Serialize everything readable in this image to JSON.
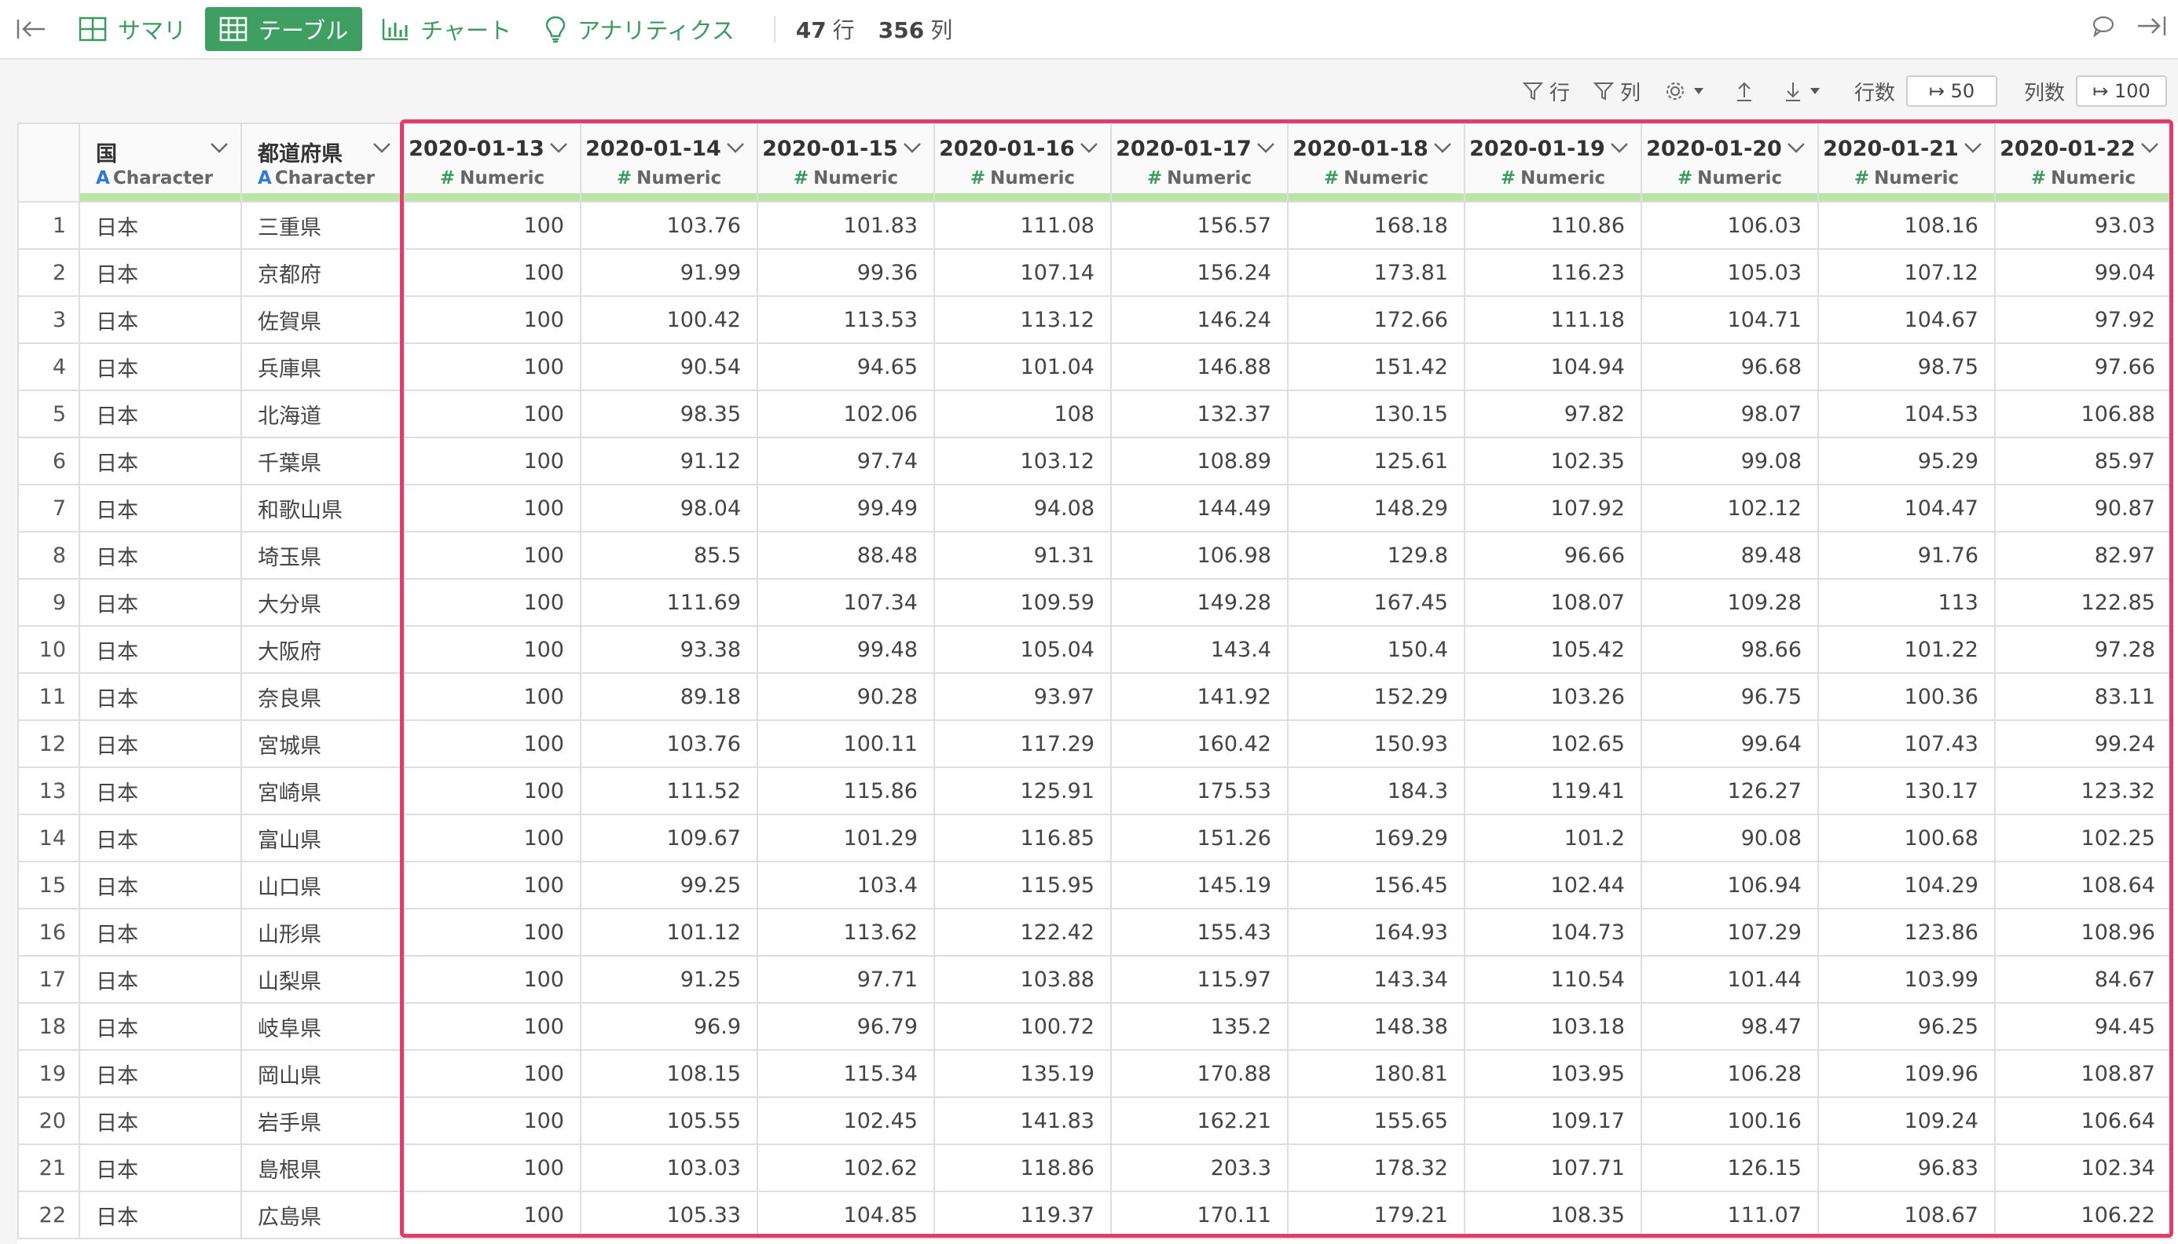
{
  "tabs": [
    {
      "label": "サマリ",
      "icon": "summary-grid-icon",
      "active": false
    },
    {
      "label": "テーブル",
      "icon": "table-icon",
      "active": true
    },
    {
      "label": "チャート",
      "icon": "bar-chart-icon",
      "active": false
    },
    {
      "label": "アナリティクス",
      "icon": "lightbulb-icon",
      "active": false
    }
  ],
  "counts": {
    "rows_value": "47",
    "rows_unit": "行",
    "cols_value": "356",
    "cols_unit": "列"
  },
  "toolbar": {
    "row_filter_label": "行",
    "col_filter_label": "列",
    "rows_label": "行数",
    "rows_value": "↦ 50",
    "cols_label": "列数",
    "cols_value": "↦ 100"
  },
  "colors": {
    "accent": "#3f9e61",
    "highlight": "#e23c6a",
    "type_bar": "#b9e6a7"
  },
  "table": {
    "columns": [
      {
        "name": "国",
        "type": "Character"
      },
      {
        "name": "都道府県",
        "type": "Character"
      },
      {
        "name": "2020-01-13",
        "type": "Numeric"
      },
      {
        "name": "2020-01-14",
        "type": "Numeric"
      },
      {
        "name": "2020-01-15",
        "type": "Numeric"
      },
      {
        "name": "2020-01-16",
        "type": "Numeric"
      },
      {
        "name": "2020-01-17",
        "type": "Numeric"
      },
      {
        "name": "2020-01-18",
        "type": "Numeric"
      },
      {
        "name": "2020-01-19",
        "type": "Numeric"
      },
      {
        "name": "2020-01-20",
        "type": "Numeric"
      },
      {
        "name": "2020-01-21",
        "type": "Numeric"
      },
      {
        "name": "2020-01-22",
        "type": "Numeric"
      }
    ],
    "rows": [
      [
        "1",
        "日本",
        "三重県",
        "100",
        "103.76",
        "101.83",
        "111.08",
        "156.57",
        "168.18",
        "110.86",
        "106.03",
        "108.16",
        "93.03"
      ],
      [
        "2",
        "日本",
        "京都府",
        "100",
        "91.99",
        "99.36",
        "107.14",
        "156.24",
        "173.81",
        "116.23",
        "105.03",
        "107.12",
        "99.04"
      ],
      [
        "3",
        "日本",
        "佐賀県",
        "100",
        "100.42",
        "113.53",
        "113.12",
        "146.24",
        "172.66",
        "111.18",
        "104.71",
        "104.67",
        "97.92"
      ],
      [
        "4",
        "日本",
        "兵庫県",
        "100",
        "90.54",
        "94.65",
        "101.04",
        "146.88",
        "151.42",
        "104.94",
        "96.68",
        "98.75",
        "97.66"
      ],
      [
        "5",
        "日本",
        "北海道",
        "100",
        "98.35",
        "102.06",
        "108",
        "132.37",
        "130.15",
        "97.82",
        "98.07",
        "104.53",
        "106.88"
      ],
      [
        "6",
        "日本",
        "千葉県",
        "100",
        "91.12",
        "97.74",
        "103.12",
        "108.89",
        "125.61",
        "102.35",
        "99.08",
        "95.29",
        "85.97"
      ],
      [
        "7",
        "日本",
        "和歌山県",
        "100",
        "98.04",
        "99.49",
        "94.08",
        "144.49",
        "148.29",
        "107.92",
        "102.12",
        "104.47",
        "90.87"
      ],
      [
        "8",
        "日本",
        "埼玉県",
        "100",
        "85.5",
        "88.48",
        "91.31",
        "106.98",
        "129.8",
        "96.66",
        "89.48",
        "91.76",
        "82.97"
      ],
      [
        "9",
        "日本",
        "大分県",
        "100",
        "111.69",
        "107.34",
        "109.59",
        "149.28",
        "167.45",
        "108.07",
        "109.28",
        "113",
        "122.85"
      ],
      [
        "10",
        "日本",
        "大阪府",
        "100",
        "93.38",
        "99.48",
        "105.04",
        "143.4",
        "150.4",
        "105.42",
        "98.66",
        "101.22",
        "97.28"
      ],
      [
        "11",
        "日本",
        "奈良県",
        "100",
        "89.18",
        "90.28",
        "93.97",
        "141.92",
        "152.29",
        "103.26",
        "96.75",
        "100.36",
        "83.11"
      ],
      [
        "12",
        "日本",
        "宮城県",
        "100",
        "103.76",
        "100.11",
        "117.29",
        "160.42",
        "150.93",
        "102.65",
        "99.64",
        "107.43",
        "99.24"
      ],
      [
        "13",
        "日本",
        "宮崎県",
        "100",
        "111.52",
        "115.86",
        "125.91",
        "175.53",
        "184.3",
        "119.41",
        "126.27",
        "130.17",
        "123.32"
      ],
      [
        "14",
        "日本",
        "富山県",
        "100",
        "109.67",
        "101.29",
        "116.85",
        "151.26",
        "169.29",
        "101.2",
        "90.08",
        "100.68",
        "102.25"
      ],
      [
        "15",
        "日本",
        "山口県",
        "100",
        "99.25",
        "103.4",
        "115.95",
        "145.19",
        "156.45",
        "102.44",
        "106.94",
        "104.29",
        "108.64"
      ],
      [
        "16",
        "日本",
        "山形県",
        "100",
        "101.12",
        "113.62",
        "122.42",
        "155.43",
        "164.93",
        "104.73",
        "107.29",
        "123.86",
        "108.96"
      ],
      [
        "17",
        "日本",
        "山梨県",
        "100",
        "91.25",
        "97.71",
        "103.88",
        "115.97",
        "143.34",
        "110.54",
        "101.44",
        "103.99",
        "84.67"
      ],
      [
        "18",
        "日本",
        "岐阜県",
        "100",
        "96.9",
        "96.79",
        "100.72",
        "135.2",
        "148.38",
        "103.18",
        "98.47",
        "96.25",
        "94.45"
      ],
      [
        "19",
        "日本",
        "岡山県",
        "100",
        "108.15",
        "115.34",
        "135.19",
        "170.88",
        "180.81",
        "103.95",
        "106.28",
        "109.96",
        "108.87"
      ],
      [
        "20",
        "日本",
        "岩手県",
        "100",
        "105.55",
        "102.45",
        "141.83",
        "162.21",
        "155.65",
        "109.17",
        "100.16",
        "109.24",
        "106.64"
      ],
      [
        "21",
        "日本",
        "島根県",
        "100",
        "103.03",
        "102.62",
        "118.86",
        "203.3",
        "178.32",
        "107.71",
        "126.15",
        "96.83",
        "102.34"
      ],
      [
        "22",
        "日本",
        "広島県",
        "100",
        "105.33",
        "104.85",
        "119.37",
        "170.11",
        "179.21",
        "108.35",
        "111.07",
        "108.67",
        "106.22"
      ]
    ]
  }
}
